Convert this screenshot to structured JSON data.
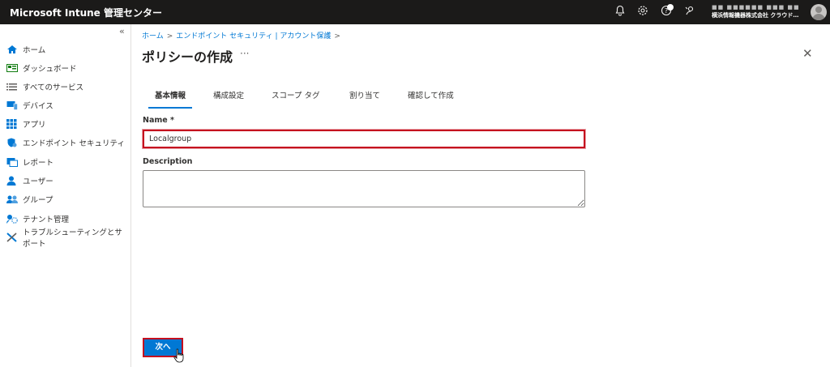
{
  "header": {
    "app_title": "Microsoft Intune 管理センター",
    "account_line1": "■■  ■■■■■■  ■■■  ■■",
    "account_line2": "横浜情報機器株式会社  クラウド…",
    "icons": [
      "bell-icon",
      "gear-icon",
      "help-icon",
      "feedback-icon"
    ]
  },
  "sidebar": {
    "collapse_glyph": "«",
    "items": [
      {
        "label": "ホーム",
        "icon": "home-icon",
        "color": "#0078d4"
      },
      {
        "label": "ダッシュボード",
        "icon": "dashboard-icon",
        "color": "#107c10"
      },
      {
        "label": "すべてのサービス",
        "icon": "services-icon",
        "color": "#605e5c"
      },
      {
        "label": "デバイス",
        "icon": "devices-icon",
        "color": "#0078d4"
      },
      {
        "label": "アプリ",
        "icon": "apps-icon",
        "color": "#0078d4"
      },
      {
        "label": "エンドポイント セキュリティ",
        "icon": "shield-icon",
        "color": "#0078d4"
      },
      {
        "label": "レポート",
        "icon": "reports-icon",
        "color": "#0078d4"
      },
      {
        "label": "ユーザー",
        "icon": "user-icon",
        "color": "#0078d4"
      },
      {
        "label": "グループ",
        "icon": "group-icon",
        "color": "#0078d4"
      },
      {
        "label": "テナント管理",
        "icon": "tenant-icon",
        "color": "#0078d4"
      },
      {
        "label": "トラブルシューティングとサポート",
        "icon": "troubleshoot-icon",
        "color": "#0078d4"
      }
    ]
  },
  "breadcrumb": {
    "items": [
      "ホーム",
      "エンドポイント セキュリティ | アカウント保護"
    ],
    "separator": ">"
  },
  "page": {
    "title": "ポリシーの作成",
    "more_glyph": "···",
    "close_glyph": "✕"
  },
  "tabs": [
    {
      "label": "基本情報",
      "active": true
    },
    {
      "label": "構成設定",
      "active": false
    },
    {
      "label": "スコープ タグ",
      "active": false
    },
    {
      "label": "割り当て",
      "active": false
    },
    {
      "label": "確認して作成",
      "active": false
    }
  ],
  "form": {
    "name_label": "Name *",
    "name_value": "Localgroup",
    "description_label": "Description",
    "description_value": ""
  },
  "footer": {
    "next_label": "次へ"
  },
  "colors": {
    "accent": "#0078d4",
    "highlight_border": "#c50f1f",
    "topbar": "#1b1a19"
  }
}
